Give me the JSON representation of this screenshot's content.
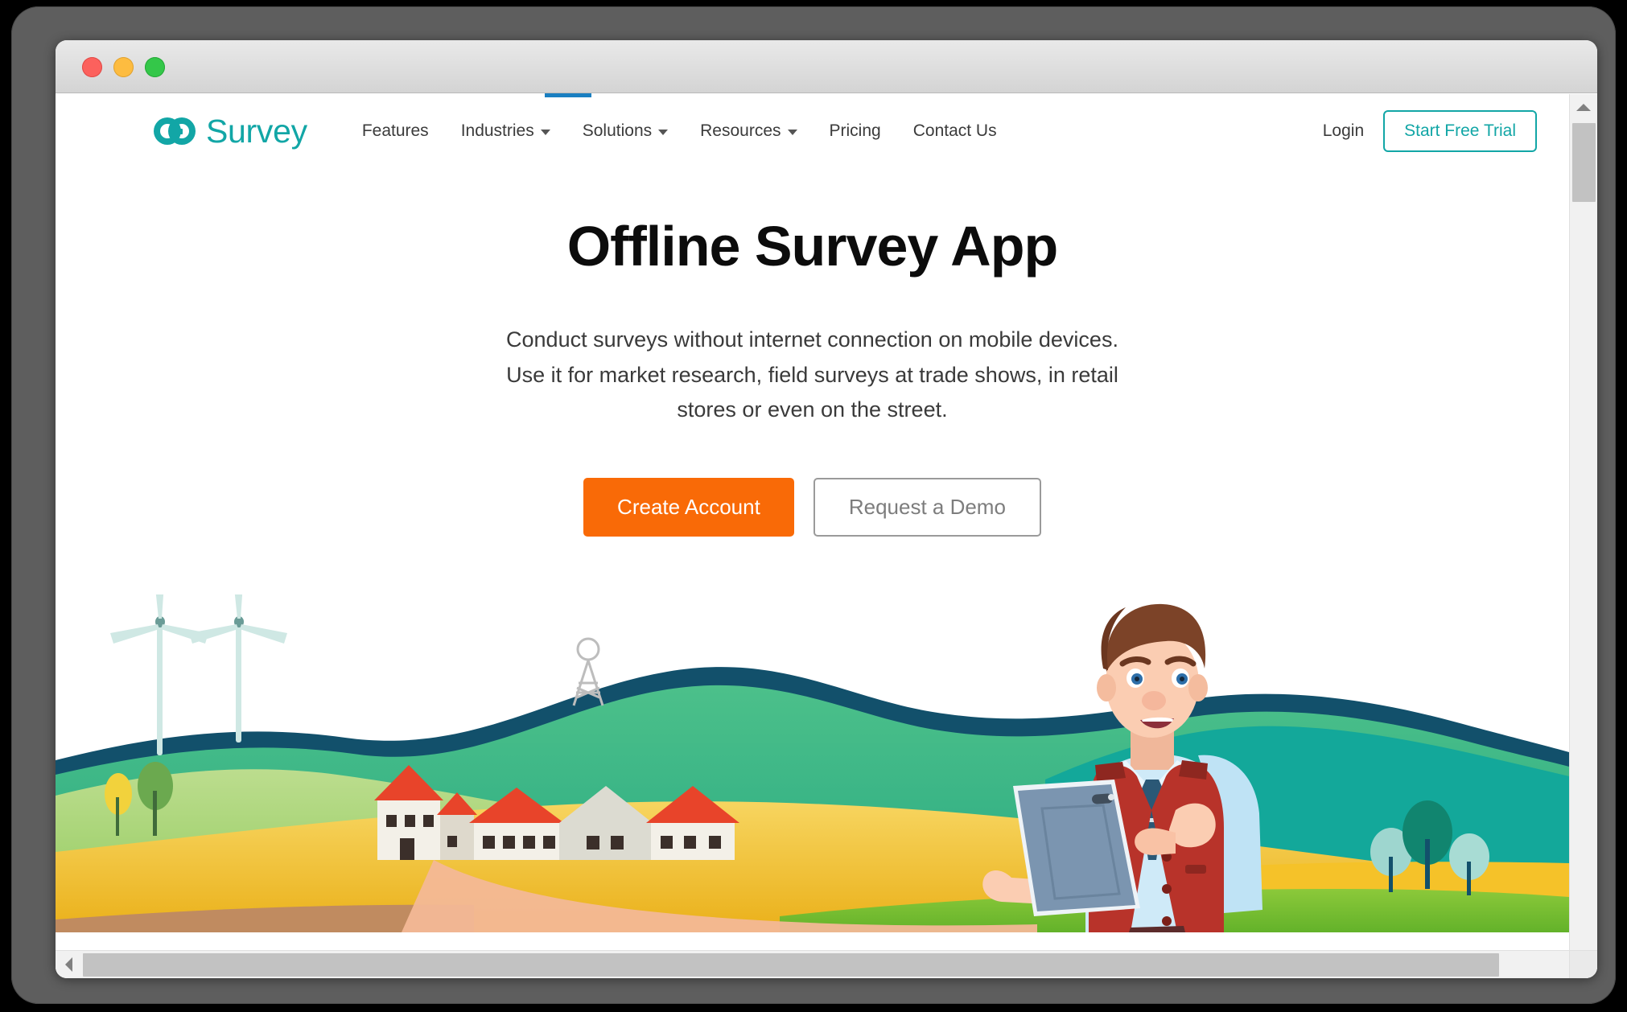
{
  "window": {
    "controls": [
      {
        "name": "close",
        "color": "#fc615d"
      },
      {
        "name": "minimize",
        "color": "#fdbc40"
      },
      {
        "name": "maximize",
        "color": "#34c749"
      }
    ],
    "loading_color": "#1a7fc1"
  },
  "brand": {
    "logo_icon": "go-logo-icon",
    "name": "Survey",
    "accent_color": "#12a6a6"
  },
  "nav": {
    "items": [
      {
        "label": "Features",
        "has_dropdown": false
      },
      {
        "label": "Industries",
        "has_dropdown": true
      },
      {
        "label": "Solutions",
        "has_dropdown": true
      },
      {
        "label": "Resources",
        "has_dropdown": true
      },
      {
        "label": "Pricing",
        "has_dropdown": false
      },
      {
        "label": "Contact Us",
        "has_dropdown": false
      }
    ],
    "login_label": "Login",
    "trial_label": "Start Free Trial"
  },
  "hero": {
    "title": "Offline Survey App",
    "subtitle": "Conduct surveys without internet connection on mobile devices. Use it for market research, field surveys at trade shows, in retail stores or even on the street.",
    "primary_cta": "Create Account",
    "secondary_cta": "Request a Demo",
    "primary_cta_color": "#f96a07"
  },
  "illustration": {
    "alt": "Man in red vest holding a tablet standing in a rural landscape with wind turbines, houses, a radio tower, hills and fields",
    "colors": {
      "dark_hill": "#12506b",
      "teal_hill": "#13a89a",
      "green_hill": "#4cc08a",
      "light_green": "#a6d98a",
      "yellow_field": "#f5c229",
      "gold_field": "#e0a32c",
      "grass": "#73bd2e",
      "path": "#f3b896",
      "roof": "#e8442a",
      "vest": "#b8332a",
      "shirt": "#bfe3f5",
      "tie": "#2b5876",
      "hair": "#7c4328",
      "tablet": "#7b95b0",
      "skin": "#fbcdb2"
    }
  },
  "scrollbars": {
    "vertical_arrow": "scroll-up-arrow",
    "horizontal_left_arrow": "scroll-left-arrow",
    "horizontal_right_arrow": "scroll-right-arrow"
  }
}
